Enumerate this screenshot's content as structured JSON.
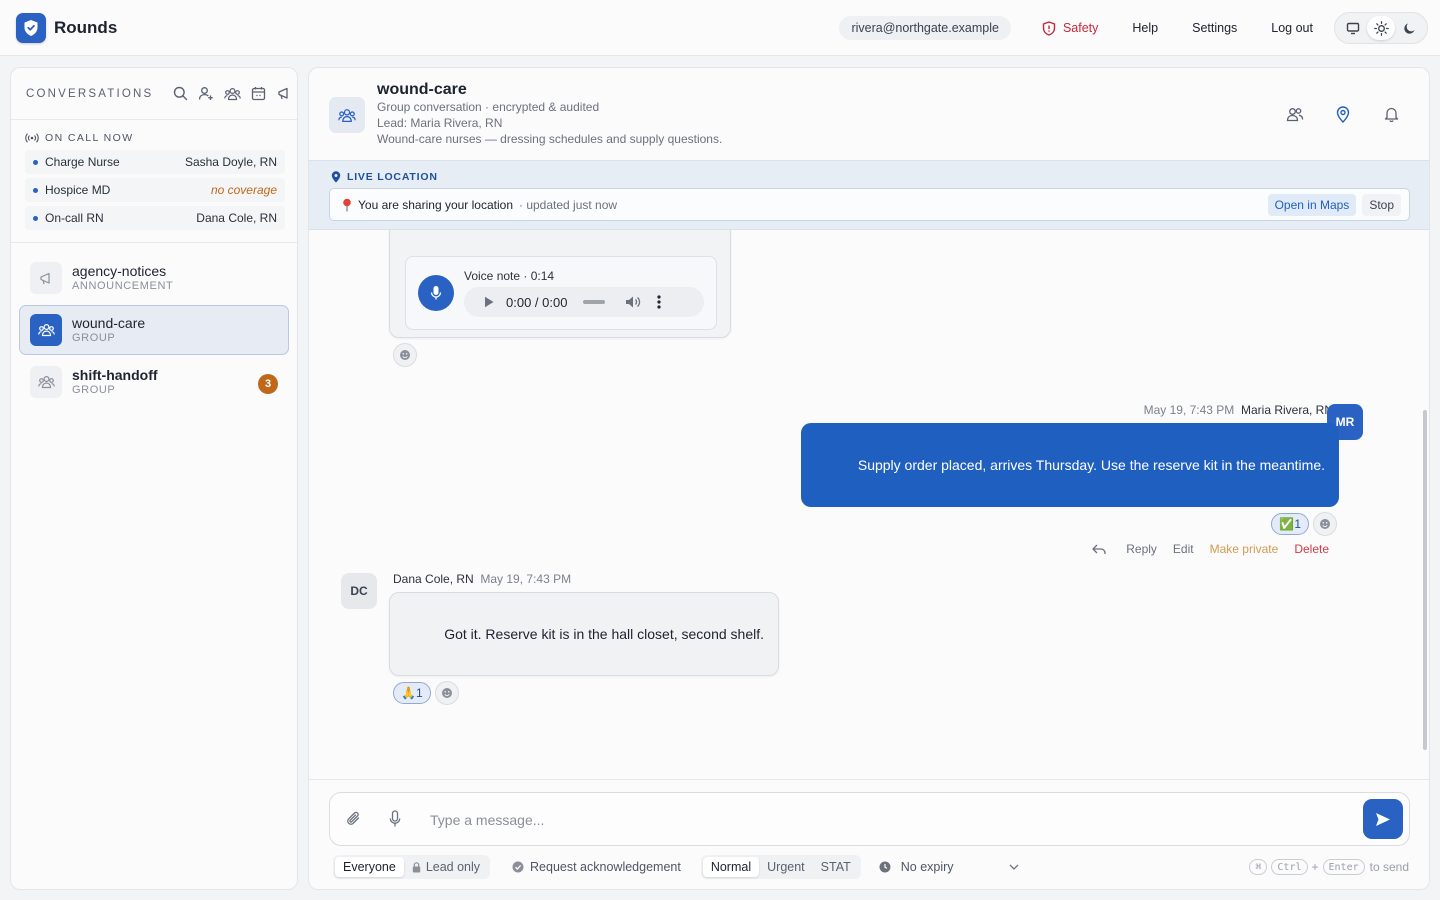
{
  "app": {
    "name": "Rounds"
  },
  "topbar": {
    "email": "rivera@northgate.example",
    "safety": "Safety",
    "help": "Help",
    "settings": "Settings",
    "logout": "Log out",
    "theme_active": "light"
  },
  "sidebar": {
    "title": "CONVERSATIONS",
    "oncall": {
      "title": "ON CALL NOW",
      "rows": [
        {
          "role": "Charge Nurse",
          "name": "Sasha Doyle, RN"
        },
        {
          "role": "Hospice MD",
          "name": "no coverage"
        },
        {
          "role": "On-call RN",
          "name": "Dana Cole, RN"
        }
      ]
    },
    "conversations": [
      {
        "name": "agency-notices",
        "type": "ANNOUNCEMENT",
        "icon": "megaphone-icon"
      },
      {
        "name": "wound-care",
        "type": "GROUP",
        "icon": "group-icon",
        "active": true
      },
      {
        "name": "shift-handoff",
        "type": "GROUP",
        "icon": "group-icon",
        "unread": "3"
      }
    ]
  },
  "channel": {
    "title": "wound-care",
    "subtitle": "Group conversation · encrypted & audited",
    "lead": "Lead: Maria Rivera, RN",
    "description": "Wound-care nurses — dressing schedules and supply questions."
  },
  "live_location": {
    "title": "LIVE LOCATION",
    "text": "You are sharing your location",
    "updated": "· updated just now",
    "open_maps": "Open in Maps",
    "stop": "Stop"
  },
  "messages": {
    "voice": {
      "label": "Voice note · 0:14",
      "time": "0:00 / 0:00"
    },
    "outgoing": {
      "timestamp": "May 19, 7:43 PM",
      "author": "Maria Rivera, RN",
      "initials": "MR",
      "text": "Supply order placed, arrives Thursday. Use the reserve kit in the meantime.",
      "reaction": "✅",
      "reaction_count": "1",
      "actions": {
        "reply": "Reply",
        "edit": "Edit",
        "private": "Make private",
        "delete": "Delete"
      }
    },
    "incoming": {
      "author": "Dana Cole, RN",
      "timestamp": "May 19, 7:43 PM",
      "initials": "DC",
      "text": "Got it. Reserve kit is in the hall closet, second shelf.",
      "reaction": "🙏",
      "reaction_count": "1"
    }
  },
  "composer": {
    "placeholder": "Type a message...",
    "audience": [
      "Everyone",
      "Lead only"
    ],
    "ack": "Request acknowledgement",
    "priority": [
      "Normal",
      "Urgent",
      "STAT"
    ],
    "expiry": "No expiry",
    "kbd_mod": "⌘",
    "kbd_ctrl": "Ctrl",
    "kbd_plus": "+",
    "kbd_enter": "Enter",
    "kbd_suffix": "to send"
  },
  "colors": {
    "accent": "#2a62c4",
    "danger": "#c6283a",
    "warning": "#c0681a"
  }
}
